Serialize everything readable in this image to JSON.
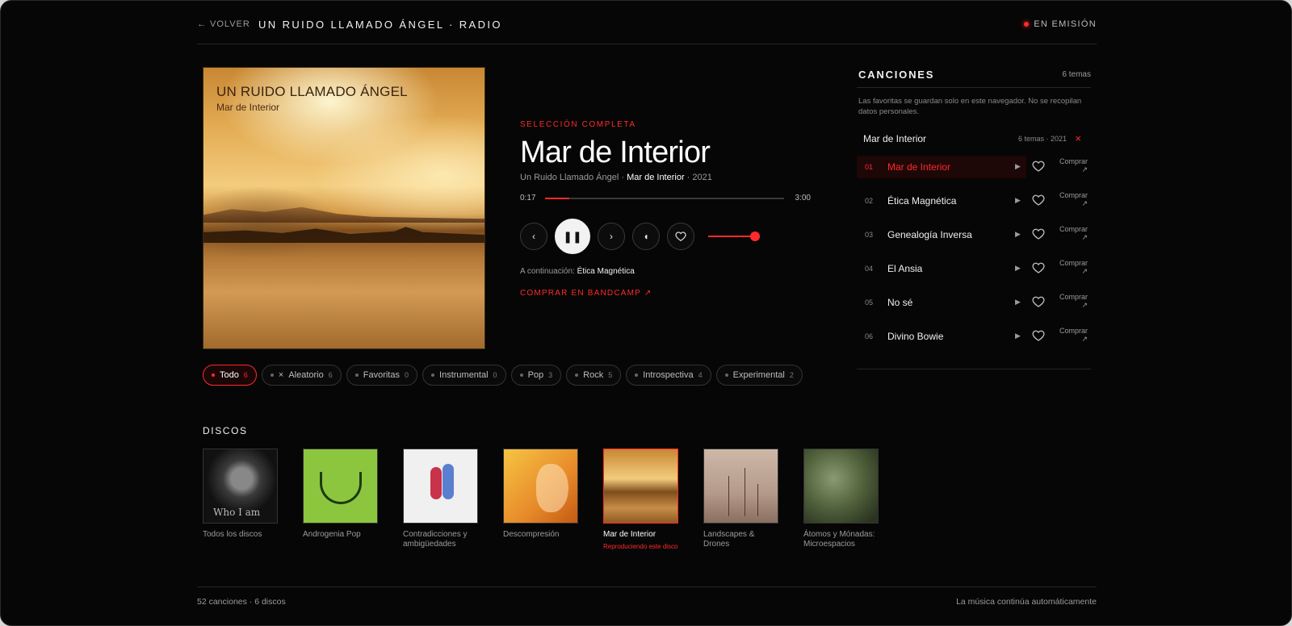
{
  "header": {
    "back_label": "VOLVER",
    "title": "UN RUIDO LLAMADO ÁNGEL · RADIO",
    "status": "EN EMISIÓN"
  },
  "cover": {
    "artist_text": "UN RUIDO LLAMADO ÁNGEL",
    "album_text": "Mar de Interior"
  },
  "player": {
    "eyebrow": "SELECCIÓN COMPLETA",
    "track_title": "Mar de Interior",
    "artist": "Un Ruido Llamado Ángel",
    "album": "Mar de Interior",
    "year": "2021",
    "elapsed": "0:17",
    "duration": "3:00",
    "progress_fraction": 0.1,
    "volume_fraction": 1.0,
    "next_label": "A continuación:",
    "next_track": "Ética Magnética",
    "buy_label": "COMPRAR EN BANDCAMP ↗"
  },
  "filters": [
    {
      "label": "Todo",
      "count": "6",
      "active": true
    },
    {
      "label": "Aleatorio",
      "count": "6",
      "prefix": "×",
      "active": false
    },
    {
      "label": "Favoritas",
      "count": "0",
      "active": false
    },
    {
      "label": "Instrumental",
      "count": "0",
      "active": false
    },
    {
      "label": "Pop",
      "count": "3",
      "active": false
    },
    {
      "label": "Rock",
      "count": "5",
      "active": false
    },
    {
      "label": "Introspectiva",
      "count": "4",
      "active": false
    },
    {
      "label": "Experimental",
      "count": "2",
      "active": false
    }
  ],
  "discs": {
    "label": "DISCOS",
    "items": [
      {
        "name": "Todos los discos",
        "cover_text": "Who I am"
      },
      {
        "name": "Androgenia Pop"
      },
      {
        "name": "Contradicciones y ambigüedades"
      },
      {
        "name": "Descompresión"
      },
      {
        "name": "Mar de Interior",
        "now": "Reproduciendo este disco"
      },
      {
        "name": "Landscapes & Drones"
      },
      {
        "name": "Átomos y Mónadas: Microespacios"
      }
    ]
  },
  "panel": {
    "title": "CANCIONES",
    "count": "6 temas",
    "note": "Las favoritas se guardan solo en este navegador. No se recopilan datos personales.",
    "album_name": "Mar de Interior",
    "album_meta": "6 temas · 2021",
    "close_label": "×",
    "buy_label": "Comprar",
    "buy_arrow": "↗",
    "tracks": [
      {
        "num": "01",
        "name": "Mar de Interior"
      },
      {
        "num": "02",
        "name": "Ética Magnética"
      },
      {
        "num": "03",
        "name": "Genealogía Inversa"
      },
      {
        "num": "04",
        "name": "El Ansia"
      },
      {
        "num": "05",
        "name": "No sé"
      },
      {
        "num": "06",
        "name": "Divino Bowie"
      }
    ]
  },
  "footer": {
    "left": "52 canciones · 6 discos",
    "right": "La música continúa automáticamente"
  },
  "colors": {
    "accent": "#ff2a2a",
    "background": "#060606"
  }
}
